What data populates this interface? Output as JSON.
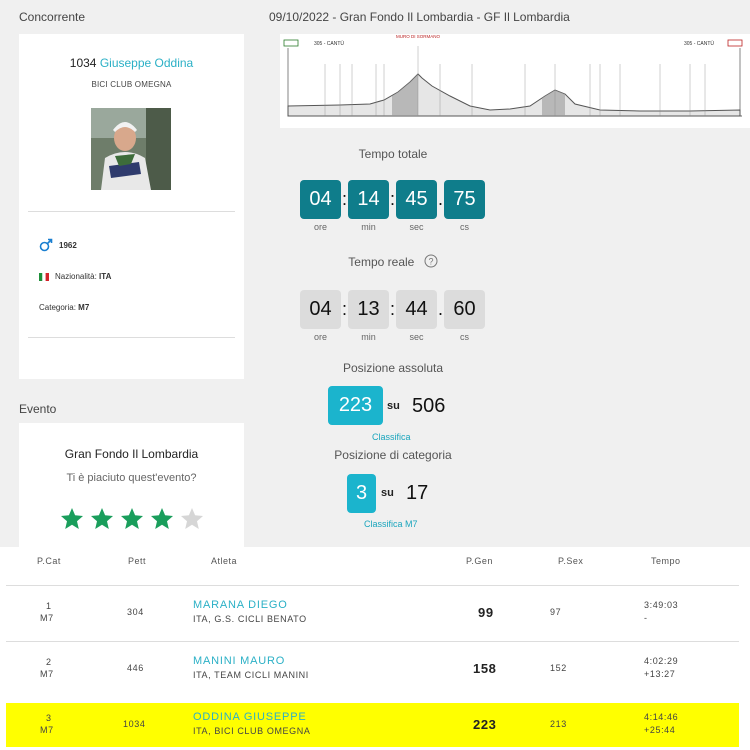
{
  "athlete_section_label": "Concorrente",
  "race_header": "09/10/2022 - Gran Fondo Il Lombardia - GF Il Lombardia",
  "athlete": {
    "bib": "1034",
    "name": "Giuseppe Oddina",
    "club": "BICI CLUB OMEGNA",
    "birth_year": "1962",
    "nationality_label": "Nazionalità:",
    "nationality": "ITA",
    "category_label": "Categoria:",
    "category": "M7"
  },
  "event_section_label": "Evento",
  "event": {
    "name": "Gran Fondo Il Lombardia",
    "question": "Ti è piaciuto quest'evento?",
    "rating": 4,
    "max_rating": 5
  },
  "profile": {
    "start_label": "305 - CANTÙ",
    "end_label": "305 - CANTÙ",
    "peak_label": "MURO DI SORMANO"
  },
  "total_time": {
    "title": "Tempo totale",
    "values": [
      "04",
      "14",
      "45",
      "75"
    ],
    "units": [
      "ore",
      "min",
      "sec",
      "cs"
    ]
  },
  "real_time": {
    "title": "Tempo reale",
    "values": [
      "04",
      "13",
      "44",
      "60"
    ],
    "units": [
      "ore",
      "min",
      "sec",
      "cs"
    ]
  },
  "abs_position": {
    "title": "Posizione assoluta",
    "value": "223",
    "su": "su",
    "total": "506",
    "link": "Classifica"
  },
  "cat_position": {
    "title": "Posizione di categoria",
    "value": "3",
    "su": "su",
    "total": "17",
    "link": "Classifica M7"
  },
  "table": {
    "headers": [
      "P.Cat",
      "Pett",
      "Atleta",
      "P.Gen",
      "P.Sex",
      "Tempo"
    ],
    "rows": [
      {
        "pcat": "1",
        "cat": "M7",
        "pett": "304",
        "name": "MARANA DIEGO",
        "club": "ITA, G.S. CICLI BENATO",
        "pgen": "99",
        "psex": "97",
        "time": "3:49:03",
        "gap": "-"
      },
      {
        "pcat": "2",
        "cat": "M7",
        "pett": "446",
        "name": "MANINI MAURO",
        "club": "ITA, TEAM CICLI MANINI",
        "pgen": "158",
        "psex": "152",
        "time": "4:02:29",
        "gap": "+13:27"
      },
      {
        "pcat": "3",
        "cat": "M7",
        "pett": "1034",
        "name": "ODDINA GIUSEPPE",
        "club": "ITA, BICI CLUB OMEGNA",
        "pgen": "223",
        "psex": "213",
        "time": "4:14:46",
        "gap": "+25:44"
      }
    ]
  },
  "colors": {
    "accent": "#2bb0c6",
    "timer_dark": "#0f7d8b",
    "position_box": "#1bb4cd",
    "star": "#1a9e5c",
    "highlight": "#ffff00"
  }
}
